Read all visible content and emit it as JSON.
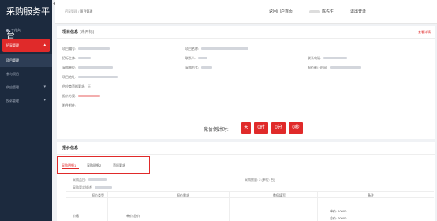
{
  "brand": "采购服务平台",
  "nav": {
    "workbench": "工作台",
    "group": "招采管理",
    "active_item": "项目管理",
    "item3": "参与项目",
    "item4": "供应管理",
    "item5": "投诉管理"
  },
  "breadcrumb": {
    "parent": "招采管理",
    "sep": "/",
    "current": "项目管理"
  },
  "topbar": {
    "portal": "返回门户首页",
    "user_label": "陈先生",
    "logout": "退出登录"
  },
  "project": {
    "title": "项目信息",
    "status": "(未开标)",
    "detail_link": "查看详情",
    "labels": {
      "code": "项目编号:",
      "name": "项目名称:",
      "org": "招标主体:",
      "contact": "联系人:",
      "phone": "联系电话:",
      "unit": "采购单位:",
      "method": "采购方式:",
      "deadline": "报价截止时间:",
      "address": "项目地址:",
      "supplier_req": "供应商资格要求:",
      "quote_plan": "报价方案:",
      "attachment": "附件附件:"
    },
    "supplier_req_value": "无"
  },
  "countdown": {
    "label": "竞价倒计时:",
    "days": "天",
    "hours": "0时",
    "minutes": "0分",
    "seconds": "0秒"
  },
  "quote": {
    "title": "报价信息",
    "tabs": [
      "采购明细1",
      "采购明细2",
      "资质要求"
    ],
    "row1_label": "采购品目:",
    "row1_qty": "采购数量: 2 (单位: 台)",
    "row2_label": "采购要求描述:",
    "table_headers": [
      "报价类型",
      "报价需求",
      "数值填写",
      "备注"
    ],
    "row_type": "价格",
    "row_req": "单价/总价",
    "notes": [
      "单价: 10000",
      "总价: 20000"
    ]
  }
}
